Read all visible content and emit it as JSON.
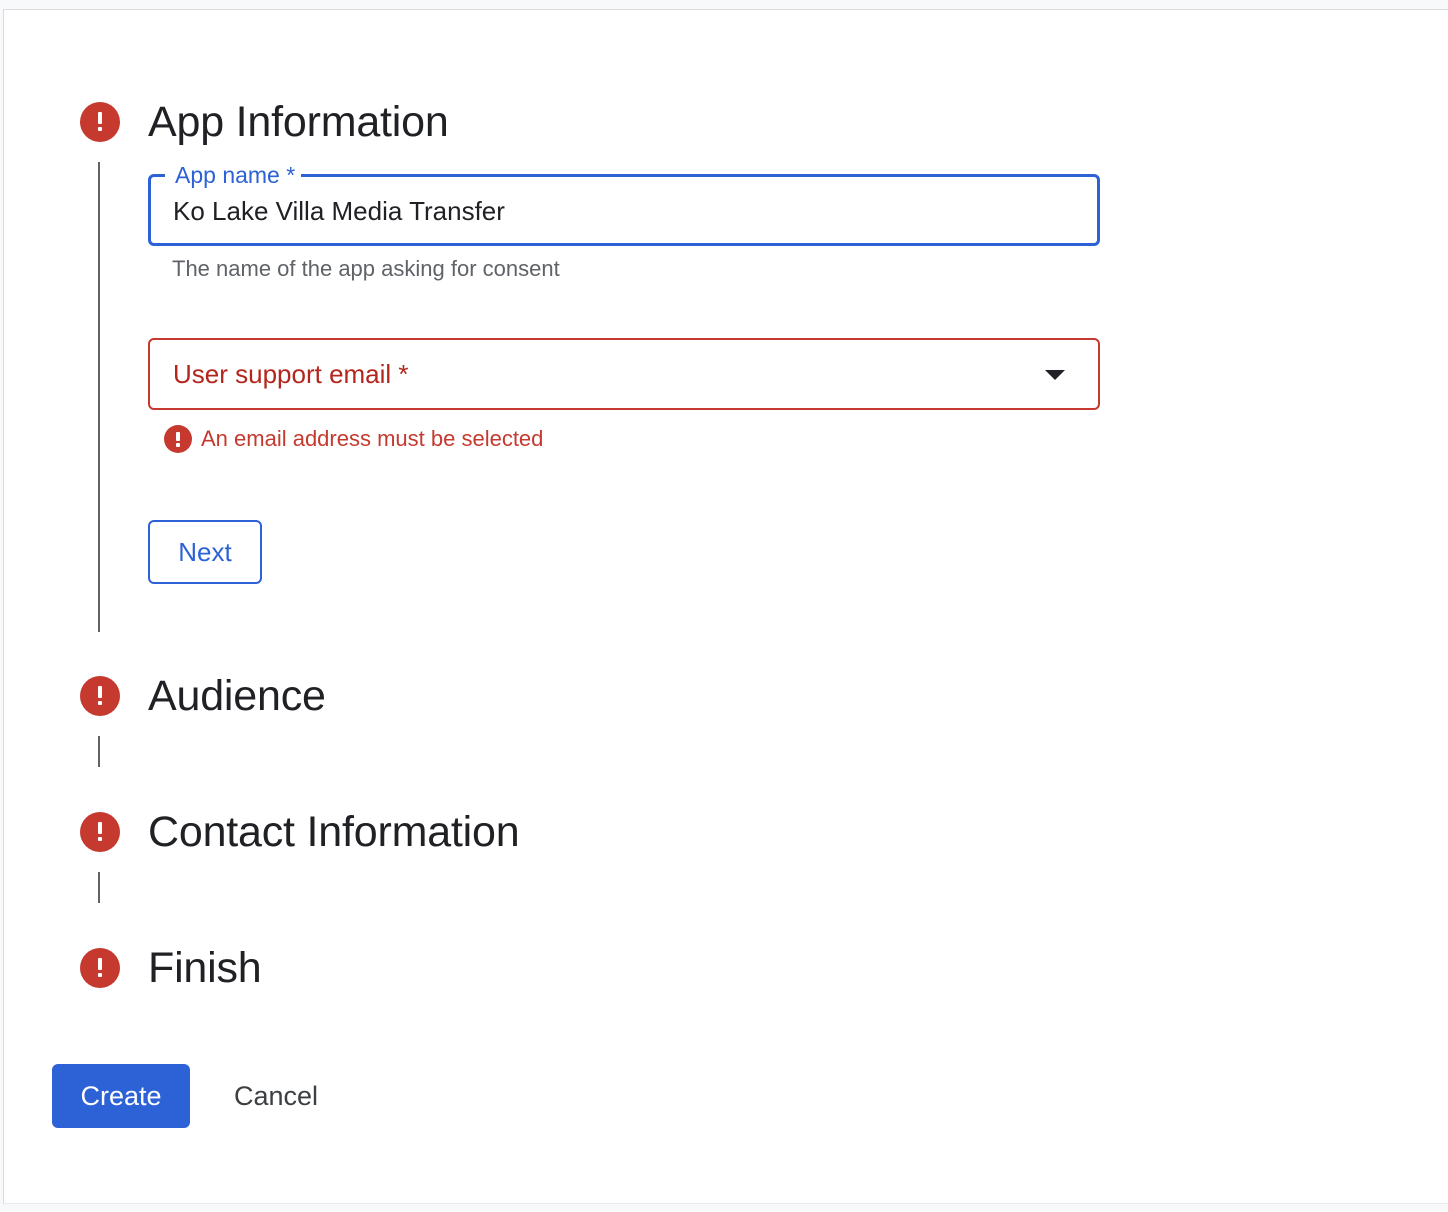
{
  "steps": [
    {
      "title": "App Information",
      "status": "error"
    },
    {
      "title": "Audience",
      "status": "error"
    },
    {
      "title": "Contact Information",
      "status": "error"
    },
    {
      "title": "Finish",
      "status": "error"
    }
  ],
  "app_name_field": {
    "label": "App name *",
    "value": "Ko Lake Villa Media Transfer",
    "hint": "The name of the app asking for consent"
  },
  "support_email_field": {
    "label": "User support email *",
    "error": "An email address must be selected",
    "icon": "dropdown-arrow-icon"
  },
  "buttons": {
    "next": "Next",
    "create": "Create",
    "cancel": "Cancel"
  },
  "colors": {
    "accent": "#2c62d6",
    "error": "#c5392f",
    "text": "#202124",
    "hint": "#5f6368"
  }
}
